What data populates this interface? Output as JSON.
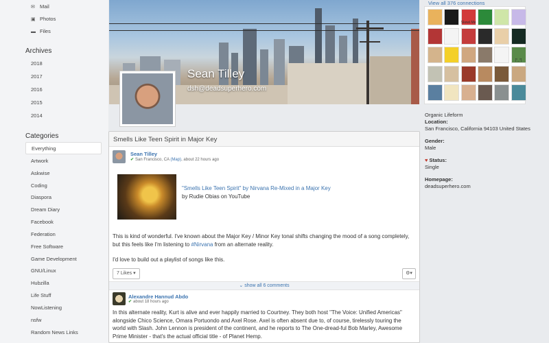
{
  "sidebar": {
    "top_items": [
      {
        "label": "Mail",
        "icon": "envelope-icon"
      },
      {
        "label": "Photos",
        "icon": "image-icon"
      },
      {
        "label": "Files",
        "icon": "folder-icon"
      }
    ],
    "archives_heading": "Archives",
    "archives": [
      "2018",
      "2017",
      "2016",
      "2015",
      "2014"
    ],
    "categories_heading": "Categories",
    "categories": [
      "Everything",
      "Artwork",
      "Askwise",
      "Coding",
      "Diaspora",
      "Dream Diary",
      "Facebook",
      "Federation",
      "Free Software",
      "Game Development",
      "GNU/Linux",
      "Hubzilla",
      "Life Stuff",
      "NowListening",
      "nsfw",
      "Random News Links"
    ]
  },
  "profile": {
    "name": "Sean Tilley",
    "handle": "dsh@deadsuperhero.com"
  },
  "connections": {
    "link_text": "View all 376 connections",
    "tiles": [
      "#e9b25c",
      "#1a1a1a",
      "#d23a3a",
      "#2c8a3a",
      "#cfe6a8",
      "#c7b9e8",
      "#b33636",
      "#f4f4f4",
      "#c43c3c",
      "#2a2a2a",
      "#e9cfa8",
      "#152a22",
      "#d4b48c",
      "#f4d028",
      "#d0a780",
      "#8a7a6a",
      "#f4f4f4",
      "#5a8a4a",
      "#c2c2b4",
      "#d6c0a0",
      "#9a3a2a",
      "#b88a60",
      "#7a5a3a",
      "#caa880",
      "#5a7fa0",
      "#f1e5c0",
      "#d8b090",
      "#6a5a50",
      "#8a9090",
      "#4a8a9a"
    ],
    "tile_labels": {
      "2": "Skewl.Me",
      "17": "[°_°]"
    }
  },
  "info": {
    "tagline": "Organic Lifeform",
    "location_label": "Location:",
    "location_value": "San Francisco, California 94103 United States",
    "gender_label": "Gender:",
    "gender_value": "Male",
    "status_label": "Status:",
    "status_value": "Single",
    "homepage_label": "Homepage:",
    "homepage_value": "deadsuperhero.com"
  },
  "post": {
    "title": "Smells Like Teen Spirit in Major Key",
    "author": "Sean Tilley",
    "location": "San Francisco, CA",
    "map_link": "(Map)",
    "time": ", about 22 hours ago",
    "embed_title": "\"Smells Like Teen Spirit\" by Nirvana Re-Mixed in a Major Key",
    "embed_sub": "by Rudie Obias on YouTube",
    "para1_a": "This is kind of wonderful. I've known about the Major Key / Minor Key tonal shifts changing the mood of a song completely, but this feels like I'm listening to ",
    "para1_tag": "#Nirvana",
    "para1_b": " from an alternate reality.",
    "para2": "I'd love to build out a playlist of songs like this.",
    "likes": "7 Likes",
    "show_comments": "show all 6 comments"
  },
  "comment": {
    "author": "Alexandre Hannud Abdo",
    "time": "about 18 hours ago",
    "text": "In this alternate reality, Kurt is alive and ever happily married to Courtney. They both host \"The Voice: Unified Americas\" alongside Chico Science, Omara Portuondo and Axel Rose. Axel is often absent due to, of course, tirelessly touring the world with Slash. John Lennon is president of the continent, and he reports to The One-dread-ful Bob Marley, Awesome Prime Minister - that's the actual official title - of Planet Hemp."
  }
}
